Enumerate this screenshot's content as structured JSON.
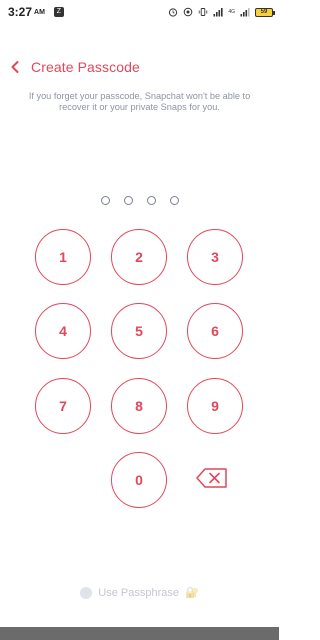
{
  "status_bar": {
    "time": "3:27",
    "ampm": "AM",
    "app_icon": "Z",
    "network_label": "4G",
    "battery": "59"
  },
  "header": {
    "title": "Create Passcode"
  },
  "info": {
    "text": "If you forget your passcode, Snapchat won't be able to recover it or your private Snaps for you."
  },
  "keypad": {
    "keys": [
      "1",
      "2",
      "3",
      "4",
      "5",
      "6",
      "7",
      "8",
      "9",
      "0"
    ]
  },
  "footer": {
    "passphrase_label": "Use Passphrase",
    "passphrase_emoji": "🔐"
  },
  "colors": {
    "accent": "#e2475b",
    "muted_text": "#8e95a3"
  }
}
